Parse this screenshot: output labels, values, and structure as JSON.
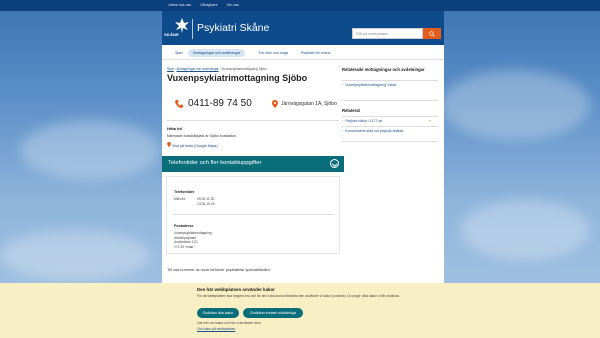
{
  "topbar": {
    "links": [
      "Jobba hos oss",
      "Vårdgivare",
      "Om oss"
    ]
  },
  "header": {
    "logo_text": "SKÅNE",
    "site_title": "Psykiatri Skåne",
    "search_placeholder": "Sök på webbplatsen"
  },
  "nav": {
    "items": [
      "Start",
      "Mottagningar och avdelningar",
      "För dom och unga",
      "Psykiatri för vuxna"
    ]
  },
  "breadcrumb": {
    "items": [
      "Start",
      "Mottagningar och avdelningar",
      "Vuxenpsykiatrimottagning Sjöbo"
    ],
    "separator": "›"
  },
  "main": {
    "title": "Vuxenpsykiatrimottagning Sjöbo",
    "phone": "0411-89 74 50",
    "address": "Järnvägsgatan 1A, Sjöbo",
    "find_title": "Hitta hit",
    "find_text": "Närmaste busshållplats är Sjöbo busstation.",
    "map_link": "Visa på karta (Google Maps)",
    "accordion_label": "Telefontider och fler kontaktuppgifter",
    "phone_times_title": "Telefontider",
    "phone_times_day": "Mån-fre",
    "phone_times_hours": [
      "09.00-11.30",
      "13.00-15.00"
    ],
    "postal_title": "Postadress",
    "postal_lines": [
      "Vuxenpsykiatrimottagning",
      "Allmänpsykiatri",
      "Avd/sektion 12C",
      "271 30 Ystad"
    ],
    "footer_text": "Till oss kommer du som behöver psykiatrisk specialistvård."
  },
  "sidebar": {
    "related_title": "Relaterade mottagningar och avdelningar",
    "related_links": [
      "Vuxenpsykiatrimottagning Ystad"
    ],
    "see_also_title": "Relaterat",
    "see_also_links": [
      "Psykisk hälsa i 1177.se",
      "Kommunens stöd vid psykisk ohälsa"
    ]
  },
  "cookie": {
    "title": "Den här webbplatsen använder kakor",
    "text": "För att webbplatsen ska fungera bra och för att vi ska kunna förbättra den använder vi kakor (cookies). Du avgör vilka kakor vi får använda.",
    "accept_all": "Godkänn alla kakor",
    "accept_necessary": "Godkänn endast nödvändiga",
    "small_text": "Läs mer om kakor och hur vi använder dem.",
    "link": "Om kakor på webbplatsen"
  },
  "colors": {
    "brand_blue": "#0e4b8c",
    "accent_orange": "#e35c1b",
    "teal": "#0a6e7a",
    "cookie_bg": "#f9efc4"
  }
}
